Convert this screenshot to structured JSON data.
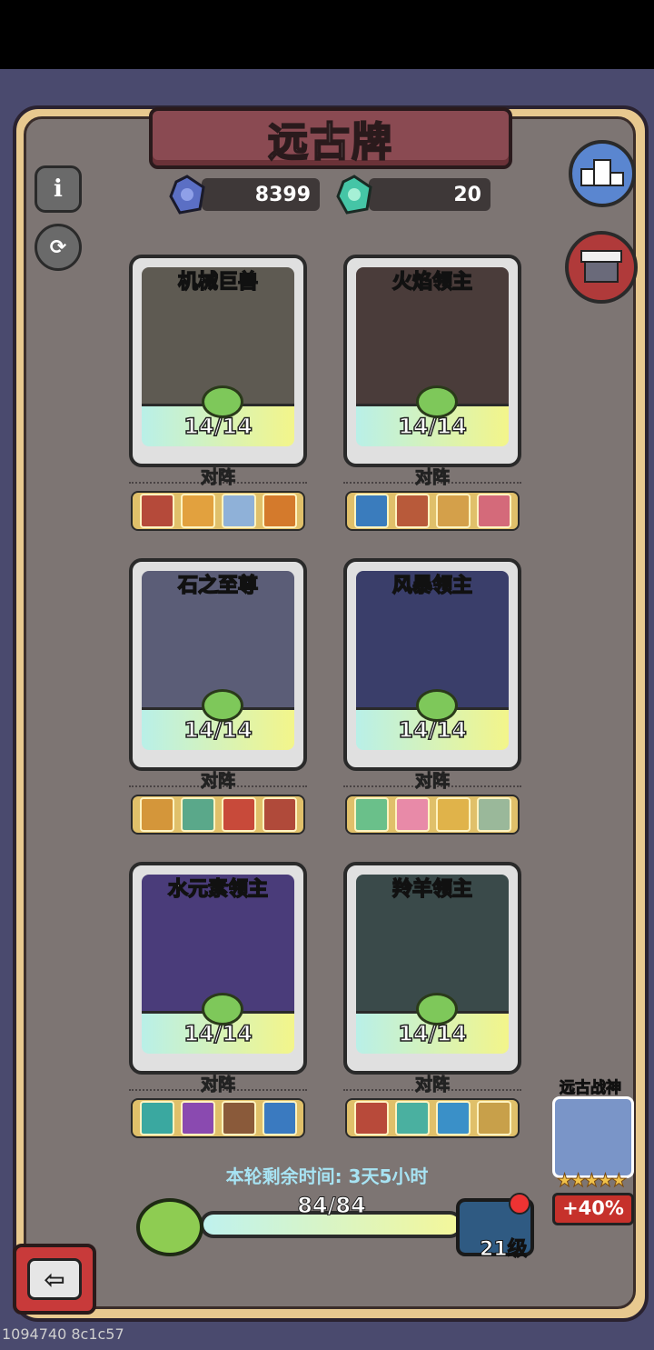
{
  "title": "远古牌",
  "currencies": [
    {
      "name": "purple-gem",
      "value": "8399",
      "color": "#5b6fc4"
    },
    {
      "name": "green-gem",
      "value": "20",
      "color": "#45c5a6"
    }
  ],
  "cards": [
    {
      "name": "机械巨兽",
      "count": "14/14",
      "lineup": "对阵",
      "art_color": "#5e5a52",
      "heroes": [
        "#b54a3a",
        "#e2a13e",
        "#8fb1d8",
        "#d47a2c"
      ]
    },
    {
      "name": "火焰领主",
      "count": "14/14",
      "lineup": "对阵",
      "art_color": "#4a3c3a",
      "heroes": [
        "#3a7cbd",
        "#b85a3a",
        "#d4a04a",
        "#d46a7a"
      ]
    },
    {
      "name": "石之至尊",
      "count": "14/14",
      "lineup": "对阵",
      "art_color": "#5b5d77",
      "heroes": [
        "#d4963a",
        "#5aa88a",
        "#c84a3a",
        "#b04a3a"
      ]
    },
    {
      "name": "风暴领主",
      "count": "14/14",
      "lineup": "对阵",
      "art_color": "#3a3e6a",
      "heroes": [
        "#6ac08a",
        "#e88aa8",
        "#e0b34a",
        "#9ab89a"
      ]
    },
    {
      "name": "水元素领主",
      "count": "14/14",
      "lineup": "对阵",
      "art_color": "#4a3c7a",
      "heroes": [
        "#3aa8a0",
        "#8a4ab0",
        "#8a5a3a",
        "#3a7ac0"
      ]
    },
    {
      "name": "羚羊领主",
      "count": "14/14",
      "lineup": "对阵",
      "art_color": "#3a4a4a",
      "heroes": [
        "#b84a3a",
        "#4ab0a0",
        "#3a90c8",
        "#c8a04a"
      ]
    }
  ],
  "timer": "本轮剩余时间: 3天5小时",
  "progress": {
    "text": "84/84",
    "fraction": 1.0
  },
  "level": "21级",
  "ancient_god": {
    "title": "远古战神",
    "stars": "★★★★★",
    "bonus": "+40%"
  },
  "watermark": "1094740 8c1c57",
  "icons": {
    "info": "info-icon",
    "refresh": "refresh-icon",
    "ranking": "ranking-icon",
    "shop": "shop-icon",
    "back": "back-arrow-icon"
  }
}
